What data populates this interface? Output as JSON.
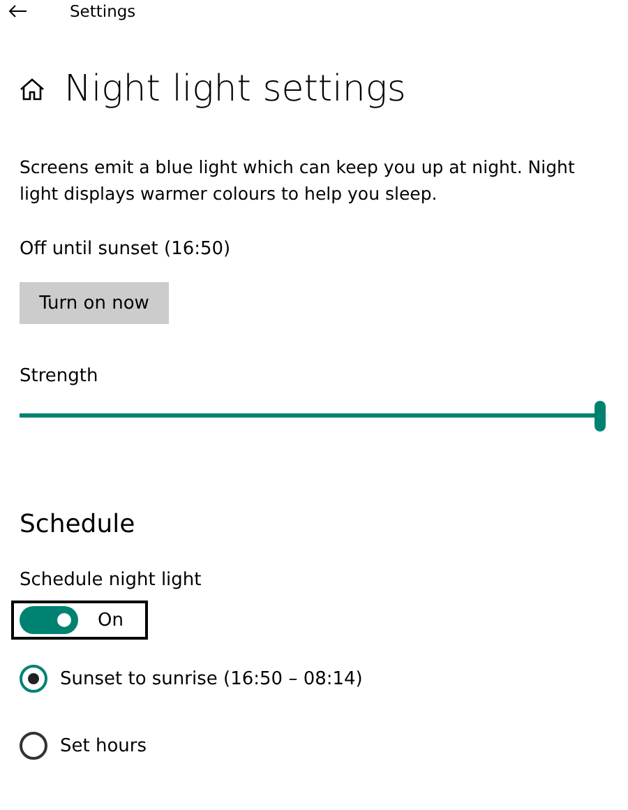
{
  "window": {
    "title": "Settings"
  },
  "page": {
    "title": "Night light settings"
  },
  "description": "Screens emit a blue light which can keep you up at night. Night light displays warmer colours to help you sleep.",
  "status": "Off until sunset (16:50)",
  "turn_on_button": "Turn on now",
  "strength": {
    "label": "Strength",
    "level": 1.0
  },
  "schedule": {
    "heading": "Schedule",
    "toggle_label": "Schedule night light",
    "toggle": {
      "on": true,
      "state_text": "On"
    },
    "options": [
      {
        "label": "Sunset to sunrise (16:50 – 08:14)",
        "selected": true
      },
      {
        "label": "Set hours",
        "selected": false
      }
    ]
  }
}
